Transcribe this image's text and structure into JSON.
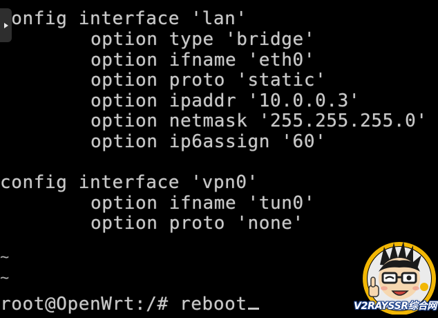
{
  "terminal": {
    "lines": [
      "config interface 'lan'",
      "option type 'bridge'",
      "option ifname 'eth0'",
      "option proto 'static'",
      "option ipaddr '10.0.0.3'",
      "option netmask '255.255.255.0'",
      "option ip6assign '60'",
      "config interface 'vpn0'",
      "option ifname 'tun0'",
      "option proto 'none'"
    ],
    "tilde": "~",
    "prompt": "root@OpenWrt:/# reboot"
  },
  "overlay": {
    "play_icon": "play-icon"
  },
  "watermark": {
    "text": "V2RAYSSR综合网",
    "icon": "mascot-logo",
    "colors": {
      "ring": "#f2b705",
      "skin": "#f6d7b0",
      "text_outline": "#1a3f8a"
    }
  }
}
